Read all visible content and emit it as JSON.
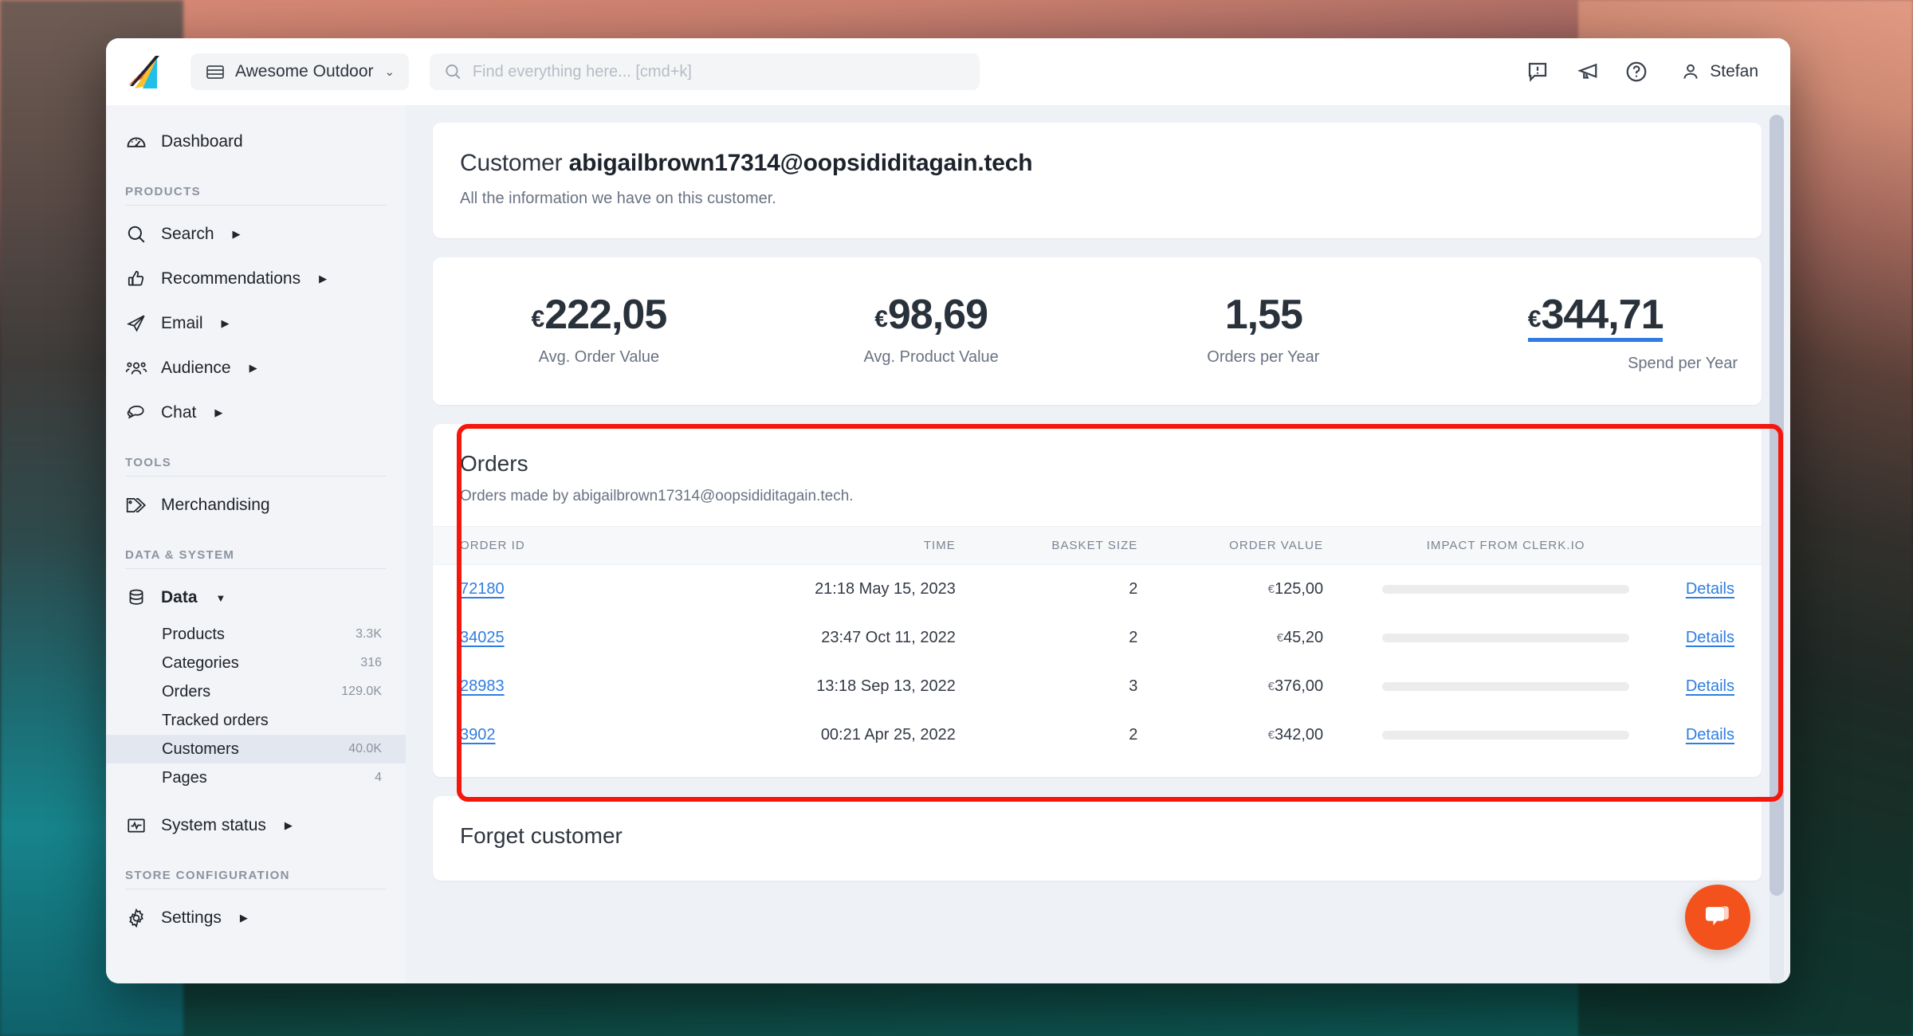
{
  "topbar": {
    "logo_name": "clerk-io-logo",
    "store_switcher": {
      "label": "Awesome Outdoor",
      "chevron": "⌄"
    },
    "search": {
      "value": "",
      "placeholder": "Find everything here... [cmd+k]"
    },
    "icons": [
      "feedback-icon",
      "announcement-icon",
      "help-icon"
    ],
    "user": {
      "name": "Stefan"
    }
  },
  "sidebar": {
    "dashboard": {
      "label": "Dashboard",
      "icon": "dashboard-icon"
    },
    "sections": [
      {
        "label": "PRODUCTS",
        "items": [
          {
            "label": "Search",
            "icon": "search-icon",
            "caret": "▶"
          },
          {
            "label": "Recommendations",
            "icon": "thumbs-up-icon",
            "caret": "▶"
          },
          {
            "label": "Email",
            "icon": "paper-plane-icon",
            "caret": "▶"
          },
          {
            "label": "Audience",
            "icon": "people-icon",
            "caret": "▶"
          },
          {
            "label": "Chat",
            "icon": "chat-bubbles-icon",
            "caret": "▶"
          }
        ]
      },
      {
        "label": "TOOLS",
        "items": [
          {
            "label": "Merchandising",
            "icon": "tag-icon",
            "caret": ""
          }
        ]
      },
      {
        "label": "DATA & SYSTEM",
        "items": [
          {
            "label": "Data",
            "icon": "database-icon",
            "caret": "▼",
            "bold": true
          },
          {
            "label": "System status",
            "icon": "activity-icon",
            "caret": "▶"
          }
        ],
        "sub_items": [
          {
            "label": "Products",
            "count": "3.3K",
            "active": false
          },
          {
            "label": "Categories",
            "count": "316",
            "active": false
          },
          {
            "label": "Orders",
            "count": "129.0K",
            "active": false
          },
          {
            "label": "Tracked orders",
            "count": "",
            "active": false
          },
          {
            "label": "Customers",
            "count": "40.0K",
            "active": true
          },
          {
            "label": "Pages",
            "count": "4",
            "active": false
          }
        ]
      },
      {
        "label": "STORE CONFIGURATION",
        "items": [
          {
            "label": "Settings",
            "icon": "gear-icon",
            "caret": "▶"
          }
        ]
      }
    ]
  },
  "customer_header": {
    "prefix": "Customer ",
    "email": "abigailbrown17314@oopsididitagain.tech",
    "subtitle": "All the information we have on this customer."
  },
  "stats": [
    {
      "currency": "€",
      "value": "222,05",
      "label": "Avg. Order Value",
      "highlight": false
    },
    {
      "currency": "€",
      "value": "98,69",
      "label": "Avg. Product Value",
      "highlight": false
    },
    {
      "currency": "",
      "value": "1,55",
      "label": "Orders per Year",
      "highlight": false
    },
    {
      "currency": "€",
      "value": "344,71",
      "label": "Spend per Year",
      "highlight": true,
      "underline_color": "#2f7de1"
    }
  ],
  "orders": {
    "title": "Orders",
    "subtitle": "Orders made by abigailbrown17314@oopsididitagain.tech.",
    "columns": [
      "ORDER ID",
      "TIME",
      "BASKET SIZE",
      "ORDER VALUE",
      "IMPACT FROM CLERK.IO",
      ""
    ],
    "details_label": "Details",
    "rows": [
      {
        "order_id": "72180",
        "time": "21:18 May 15, 2023",
        "basket_size": "2",
        "currency": "€",
        "order_value": "125,00",
        "impact": ""
      },
      {
        "order_id": "34025",
        "time": "23:47 Oct 11, 2022",
        "basket_size": "2",
        "currency": "€",
        "order_value": "45,20",
        "impact": ""
      },
      {
        "order_id": "28983",
        "time": "13:18 Sep 13, 2022",
        "basket_size": "3",
        "currency": "€",
        "order_value": "376,00",
        "impact": ""
      },
      {
        "order_id": "3902",
        "time": "00:21 Apr 25, 2022",
        "basket_size": "2",
        "currency": "€",
        "order_value": "342,00",
        "impact": ""
      }
    ]
  },
  "forget": {
    "title": "Forget customer"
  },
  "annotation": {
    "color": "#f5170c",
    "target": "orders-card"
  },
  "chat_widget": {
    "icon": "chat-bubble-icon",
    "color": "#f3521c"
  }
}
